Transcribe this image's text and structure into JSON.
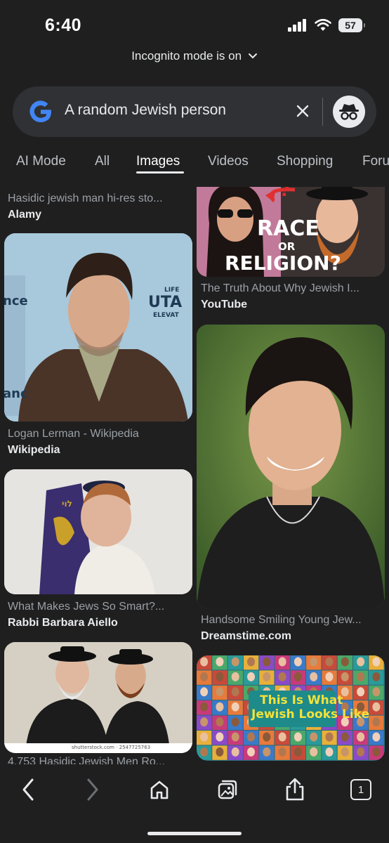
{
  "status_bar": {
    "time": "6:40",
    "battery": "57",
    "icons": [
      "signal-icon",
      "wifi-icon",
      "battery-icon"
    ]
  },
  "incognito_banner": {
    "label": "Incognito mode is on"
  },
  "search": {
    "query": "A random Jewish person",
    "icons": [
      "google-logo",
      "clear-icon",
      "incognito-icon"
    ]
  },
  "tabs": [
    {
      "label": "AI Mode"
    },
    {
      "label": "All"
    },
    {
      "label": "Images",
      "active": true
    },
    {
      "label": "Videos"
    },
    {
      "label": "Shopping"
    },
    {
      "label": "Foru"
    }
  ],
  "results": {
    "left": [
      {
        "caption": "Hasidic jewish man hi-res sto...",
        "source": "Alamy"
      },
      {
        "caption": "Logan Lerman - Wikipedia",
        "source": "Wikipedia",
        "image_text": [
          "nce",
          "LIFE",
          "UTA",
          "ELEVAT",
          "anc"
        ]
      },
      {
        "caption": "What Makes Jews So Smart?...",
        "source": "Rabbi Barbara Aiello",
        "image_text": [
          "לוי"
        ]
      },
      {
        "caption": "4,753 Hasidic Jewish Men Ro...",
        "source": "",
        "image_text": [
          "shutterstock.com · 2547725763"
        ]
      }
    ],
    "right": [
      {
        "caption": "The Truth About Why Jewish I...",
        "source": "YouTube",
        "image_text": [
          "RACE",
          "OR",
          "RELIGION?",
          "?"
        ]
      },
      {
        "caption": "Handsome Smiling Young Jew...",
        "source": "Dreamstime.com"
      },
      {
        "caption": "",
        "source": "",
        "image_text": [
          "This Is What",
          "Jewish Looks Like"
        ]
      }
    ]
  },
  "toolbar": {
    "tab_count": "1",
    "icons": [
      "back-icon",
      "forward-icon",
      "home-icon",
      "gallery-icon",
      "share-icon",
      "tabs-icon"
    ]
  },
  "colors": {
    "background": "#1f1f1f",
    "search_bg": "#303134",
    "text": "#e8eaed",
    "muted": "#9aa0a6"
  }
}
